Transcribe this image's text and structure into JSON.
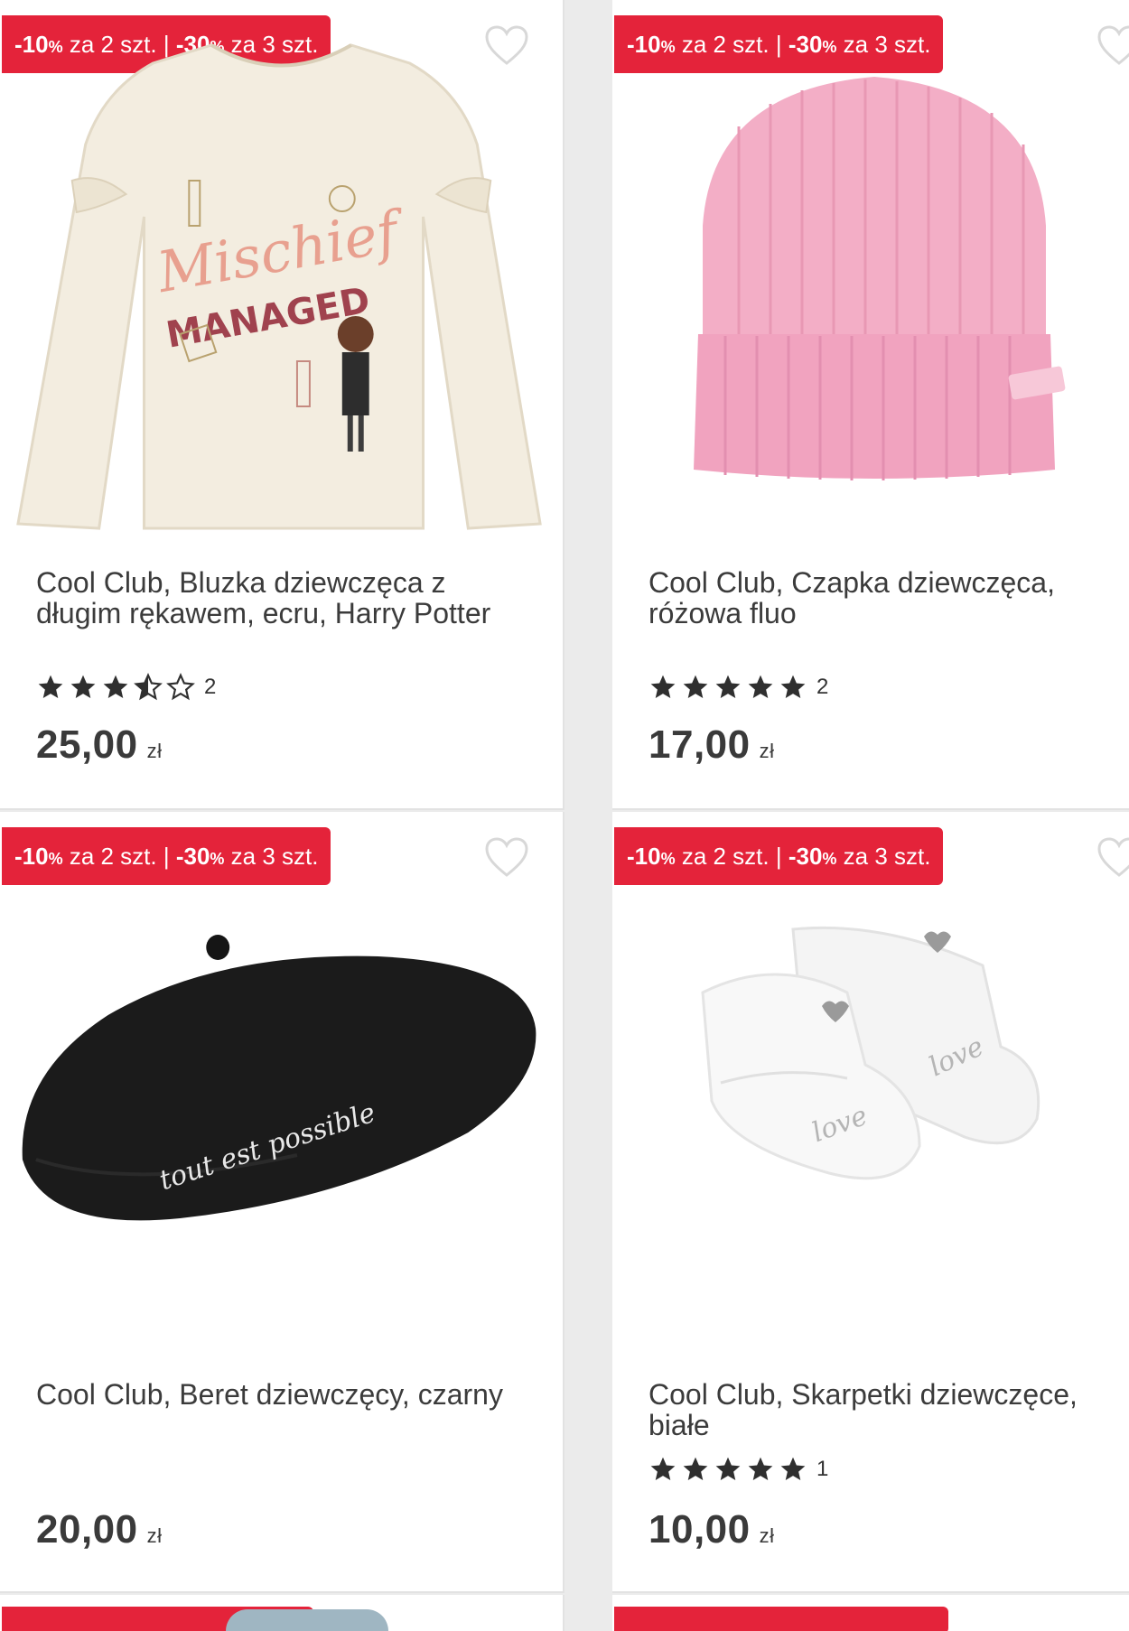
{
  "promo": {
    "pct1": "-10",
    "sign1": "%",
    "text1": " za 2 szt. | ",
    "pct2": "-30",
    "sign2": "%",
    "text2": " za 3 szt."
  },
  "colors": {
    "promo_bg": "#e4233a",
    "card_bg": "#ffffff",
    "page_bg": "#ebebeb"
  },
  "products": [
    {
      "title_line1": "Cool Club, Bluzka dziewczęca z",
      "title_line2": "długim rękawem, ecru, Harry Potter",
      "image_icon": "harry-potter-sweatshirt",
      "print_line1": "Mischief",
      "print_line2": "MANAGED",
      "label": "Harry Potter",
      "rating": 3.5,
      "review_count": "2",
      "price": "25,00",
      "currency": "zł"
    },
    {
      "title_line1": "Cool Club, Czapka dziewczęca,",
      "title_line2": "różowa fluo",
      "image_icon": "pink-beanie",
      "rating": 5,
      "review_count": "2",
      "price": "17,00",
      "currency": "zł"
    },
    {
      "title_line1": "Cool Club, Beret dziewczęcy, czarny",
      "title_line2": "",
      "image_icon": "black-beret",
      "print_line1": "tout est possible",
      "rating": null,
      "review_count": "",
      "price": "20,00",
      "currency": "zł"
    },
    {
      "title_line1": "Cool Club, Skarpetki dziewczęce,",
      "title_line2": "białe",
      "image_icon": "white-baby-socks",
      "print_line1": "love",
      "print_line2": "love",
      "rating": 5,
      "review_count": "1",
      "price": "10,00",
      "currency": "zł"
    }
  ]
}
